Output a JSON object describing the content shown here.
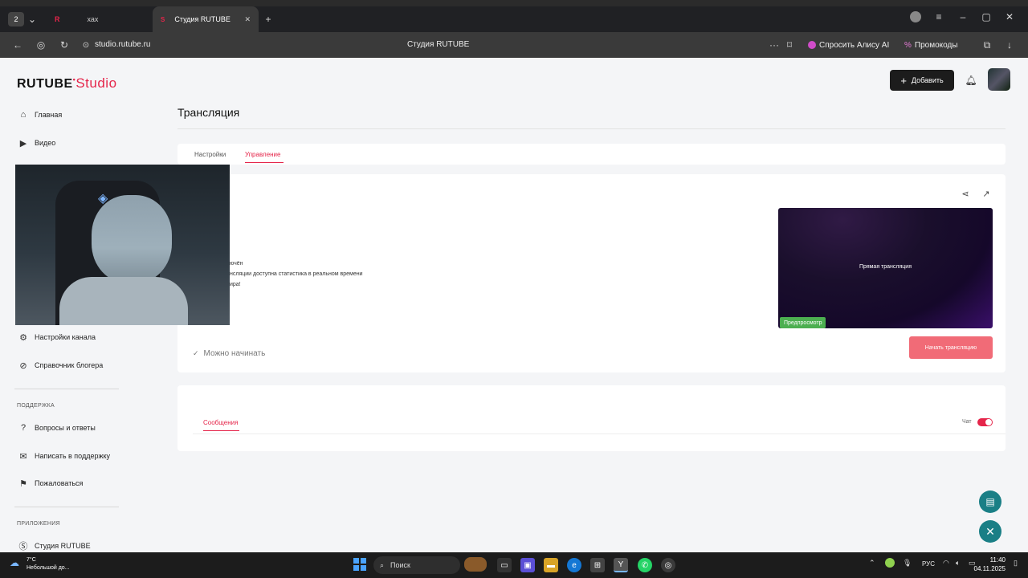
{
  "browser": {
    "tab_badge": "2",
    "tab1_label": "хах",
    "tab2_label": "Студия RUTUBE",
    "address": "studio.rutube.ru",
    "page_title": "Студия RUTUBE",
    "alice_label": "Спросить Алису AI",
    "promo_label": "Промокоды"
  },
  "header": {
    "logo_main": "RUTUBE",
    "logo_studio": "Studio",
    "add_button": "Добавить"
  },
  "sidebar": {
    "items": [
      {
        "label": "Главная",
        "icon": "home-icon"
      },
      {
        "label": "Видео",
        "icon": "video-icon"
      },
      {
        "label": "Настройки канала",
        "icon": "gear-icon"
      },
      {
        "label": "Справочник блогера",
        "icon": "book-icon"
      }
    ],
    "support_heading": "ПОДДЕРЖКА",
    "support_items": [
      {
        "label": "Вопросы и ответы"
      },
      {
        "label": "Написать в поддержку"
      },
      {
        "label": "Пожаловаться"
      }
    ],
    "apps_heading": "ПРИЛОЖЕНИЯ",
    "apps_items": [
      {
        "label": "Студия RUTUBE"
      }
    ]
  },
  "main": {
    "title": "Трансляция",
    "tabs": [
      {
        "label": "Настройки"
      },
      {
        "label": "Управление"
      }
    ],
    "status_line1": "ючён",
    "status_line2": "нсляции доступна статистика в реальном времени",
    "status_line3": "ира!",
    "ready_label": "Можно начинать",
    "preview_title": "Прямая трансляция",
    "preview_badge": "Предпросмотр",
    "start_button": "Начать трансляцию",
    "messages_tab": "Сообщения",
    "chat_label": "Чат"
  },
  "taskbar": {
    "weather_temp": "7°C",
    "weather_text": "Небольшой до...",
    "search_label": "Поиск",
    "lang": "РУС",
    "time": "11:40",
    "date": "04.11.2025"
  },
  "colors": {
    "accent": "#e5254a",
    "button": "#f16b77",
    "preview_badge": "#4caf50"
  }
}
